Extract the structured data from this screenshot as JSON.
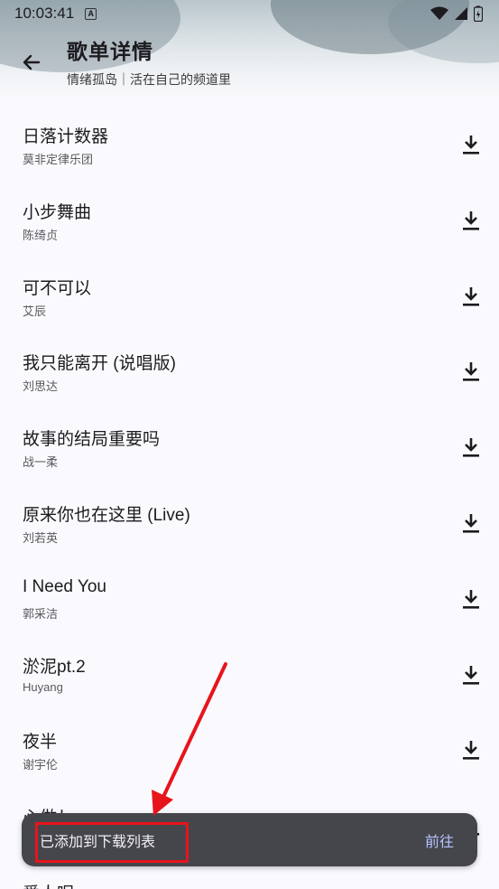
{
  "status_bar": {
    "time": "10:03:41",
    "notification_icon": "A"
  },
  "header": {
    "title": "歌单详情",
    "subtitle": "情绪孤岛｜活在自己的频道里",
    "back_icon": "arrow-left-icon"
  },
  "songs": [
    {
      "title": "日落计数器",
      "artist": "莫非定律乐团"
    },
    {
      "title": "小步舞曲",
      "artist": "陈绮贞"
    },
    {
      "title": "可不可以",
      "artist": "艾辰"
    },
    {
      "title": "我只能离开 (说唱版)",
      "artist": "刘思达"
    },
    {
      "title": "故事的结局重要吗",
      "artist": "战一柔"
    },
    {
      "title": "原来你也在这里 (Live)",
      "artist": "刘若英"
    },
    {
      "title": "I Need You",
      "artist": "郭采洁"
    },
    {
      "title": "淤泥pt.2",
      "artist": "Huyang"
    },
    {
      "title": "夜半",
      "artist": "谢宇伦"
    },
    {
      "title": "心做し",
      "artist": ""
    },
    {
      "title": "爱人呢",
      "artist": ""
    }
  ],
  "snackbar": {
    "message": "已添加到下载列表",
    "action": "前往"
  },
  "colors": {
    "snackbar_bg": "#45454c",
    "snackbar_action": "#b6c4ff",
    "annotation_red": "#e8141b"
  }
}
